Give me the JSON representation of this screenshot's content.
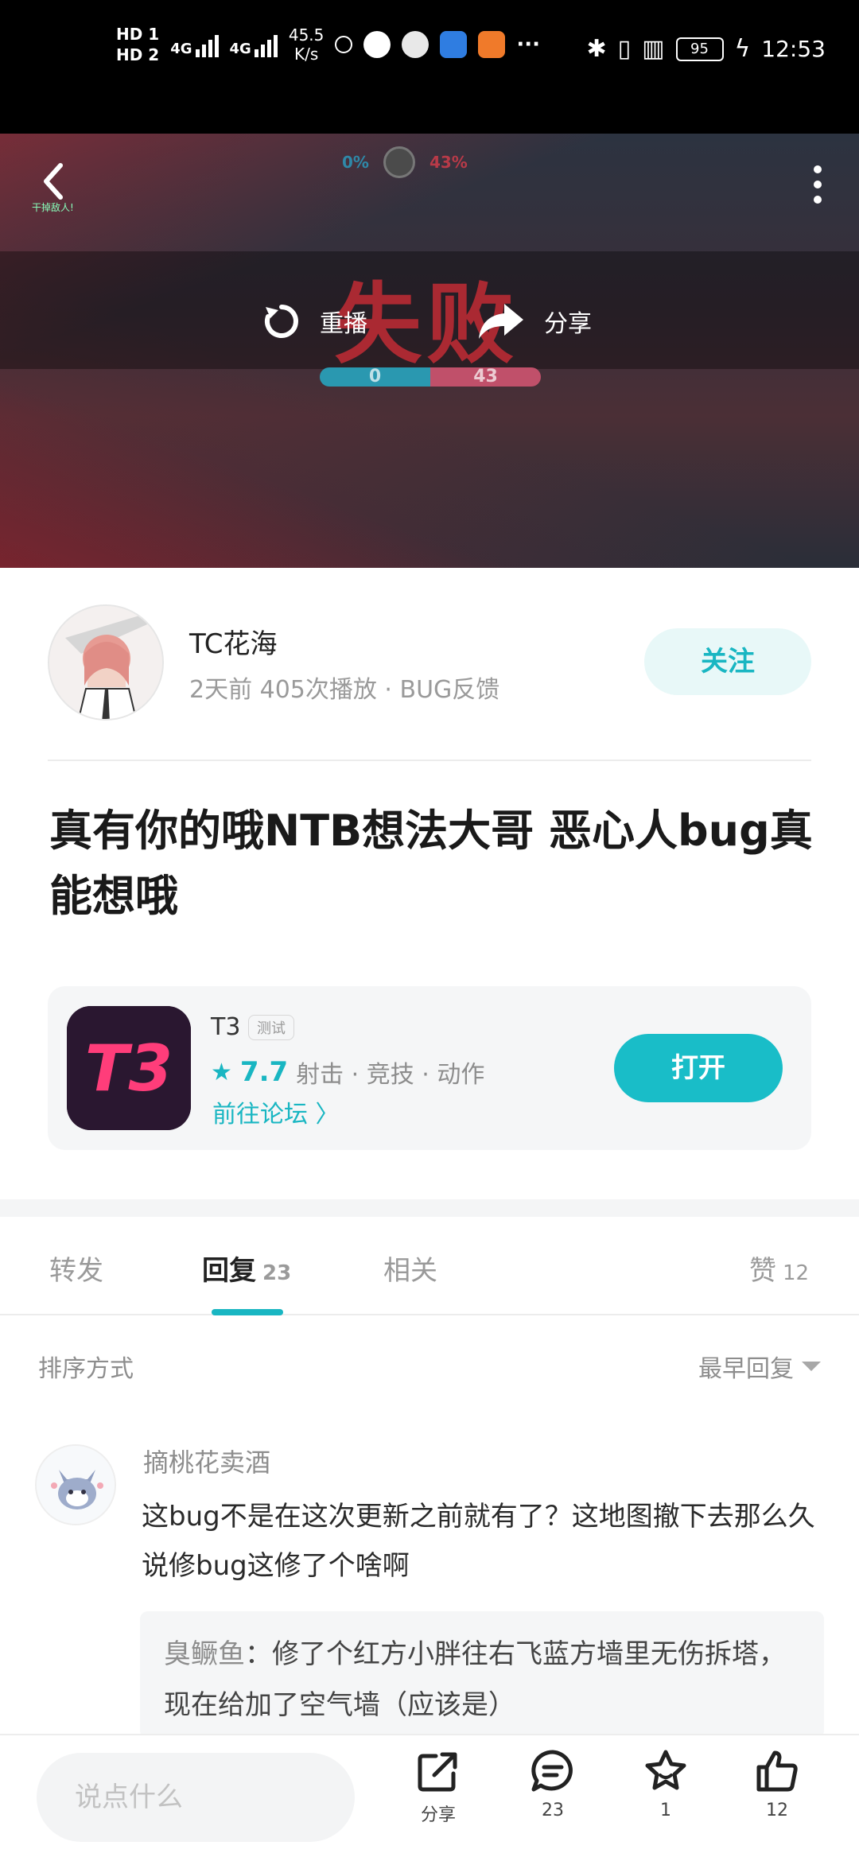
{
  "status_bar": {
    "hd1": "HD 1",
    "hd2": "HD 2",
    "net1": "4G",
    "net2": "4G",
    "speed_value": "45.5",
    "speed_unit": "K/s",
    "more": "···",
    "battery": "95",
    "time": "12:53"
  },
  "video": {
    "score_left": "0%",
    "score_right": "43%",
    "kill_note": "干掉敌人!",
    "result_text": "失败",
    "replay_label": "重播",
    "share_label": "分享",
    "score_bar_left": "0",
    "score_bar_right": "43"
  },
  "author": {
    "name": "TC花海",
    "meta": "2天前   405次播放 · BUG反馈",
    "follow_label": "关注"
  },
  "post": {
    "title": "真有你的哦NTB想法大哥 恶心人bug真能想哦"
  },
  "game_card": {
    "icon_text": "T3",
    "name": "T3",
    "tag": "测试",
    "score": "7.7",
    "genres": "射击 · 竞技 · 动作",
    "forum_link": "前往论坛 〉",
    "open_label": "打开"
  },
  "tabs": {
    "forward": "转发",
    "reply": "回复",
    "reply_count": "23",
    "related": "相关",
    "like": "赞",
    "like_count": "12"
  },
  "sort": {
    "label": "排序方式",
    "value": "最早回复"
  },
  "comment": {
    "user": "摘桃花卖酒",
    "text": "这bug不是在这次更新之前就有了？这地图撤下去那么久说修bug这修了个啥啊",
    "reply_user": "臭鳜鱼",
    "reply_text": "：修了个红方小胖往右飞蓝方墙里无伤拆塔，现在给加了空气墙（应该是）"
  },
  "bottom_bar": {
    "input_placeholder": "说点什么",
    "share_label": "分享",
    "comment_count": "23",
    "fav_count": "1",
    "like_count": "12"
  },
  "colors": {
    "accent": "#19b6c2",
    "follow_bg": "#e8f8f8",
    "game_icon_bg": "#2a1730",
    "game_icon_fg": "#ff3d7a"
  }
}
